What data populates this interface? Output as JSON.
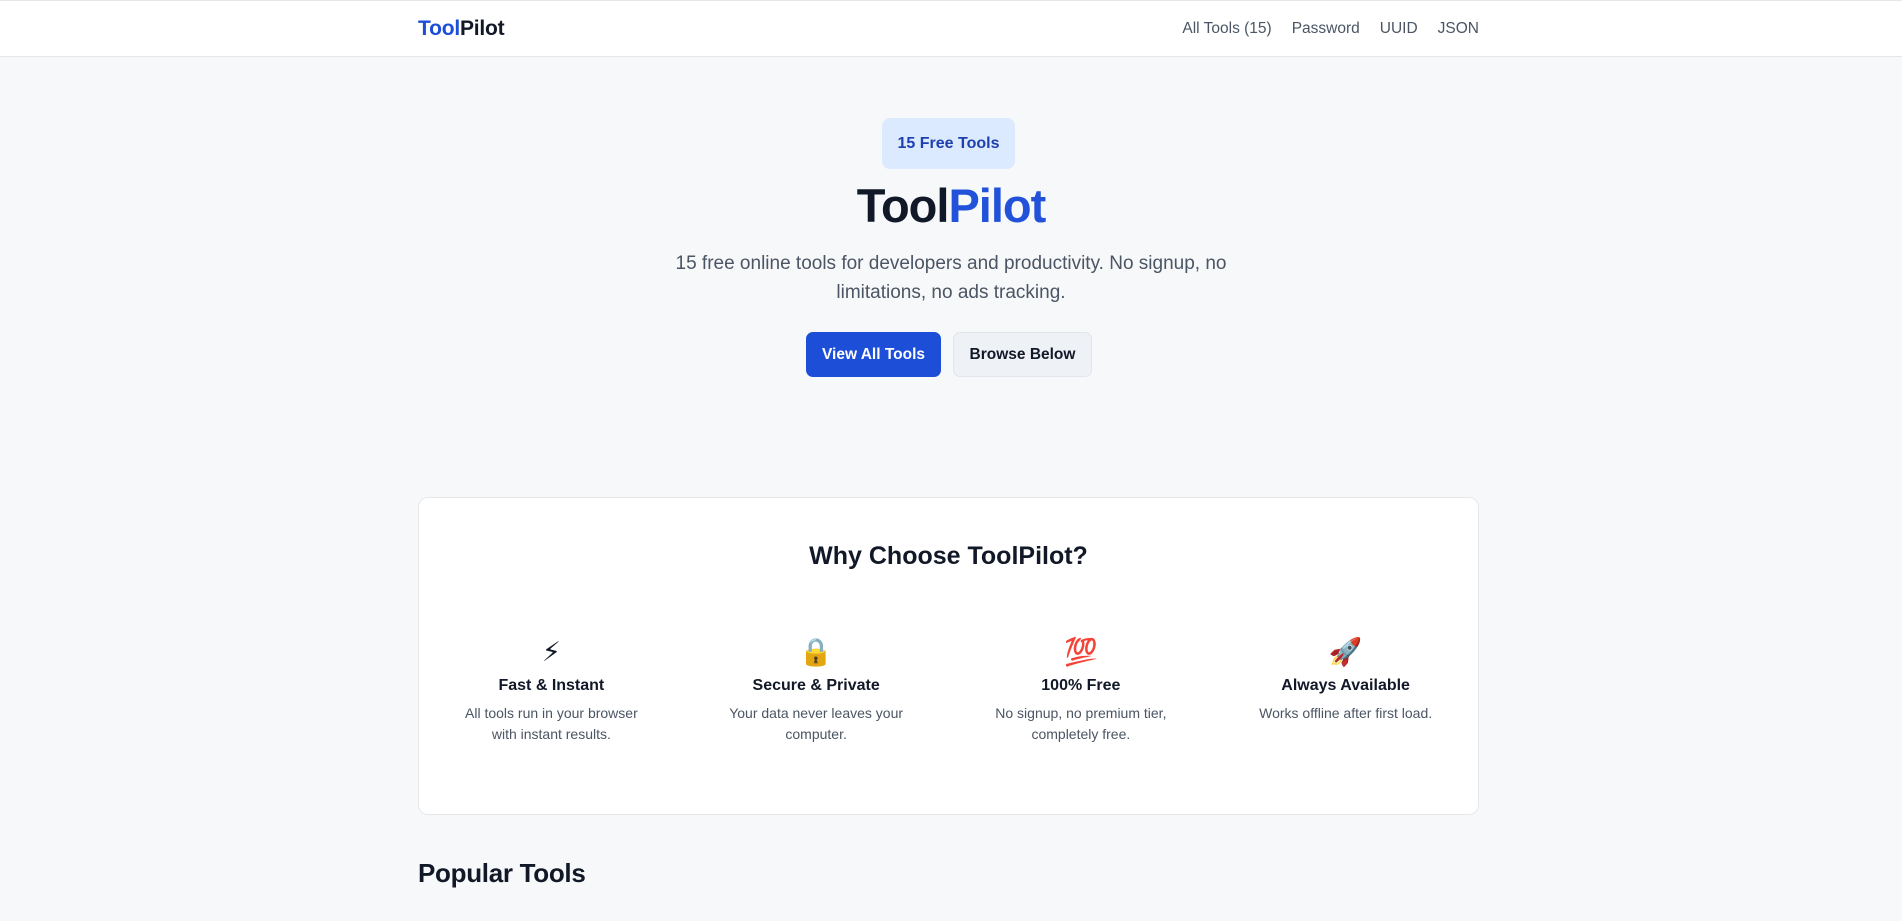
{
  "header": {
    "logo_part1": "Tool",
    "logo_part2": "Pilot",
    "nav": [
      "All Tools (15)",
      "Password",
      "UUID",
      "JSON"
    ]
  },
  "hero": {
    "badge": "15 Free Tools",
    "title_part1": "Tool",
    "title_part2": "Pilot",
    "subtitle": "15 free online tools for developers and productivity. No signup, no limitations, no ads tracking.",
    "primary_button": "View All Tools",
    "secondary_button": "Browse Below"
  },
  "why": {
    "title": "Why Choose ToolPilot?",
    "features": [
      {
        "icon": "⚡",
        "icon_name": "lightning-icon",
        "title": "Fast & Instant",
        "desc": "All tools run in your browser with instant results."
      },
      {
        "icon": "🔒",
        "icon_name": "lock-icon",
        "title": "Secure & Private",
        "desc": "Your data never leaves your computer."
      },
      {
        "icon": "💯",
        "icon_name": "hundred-points-icon",
        "title": "100% Free",
        "desc": "No signup, no premium tier, completely free."
      },
      {
        "icon": "🚀",
        "icon_name": "rocket-icon",
        "title": "Always Available",
        "desc": "Works offline after first load."
      }
    ]
  },
  "popular": {
    "title": "Popular Tools"
  },
  "colors": {
    "accent": "#1d4ed8",
    "badge_bg": "#dbeafe",
    "page_bg": "#f7f8fa"
  }
}
